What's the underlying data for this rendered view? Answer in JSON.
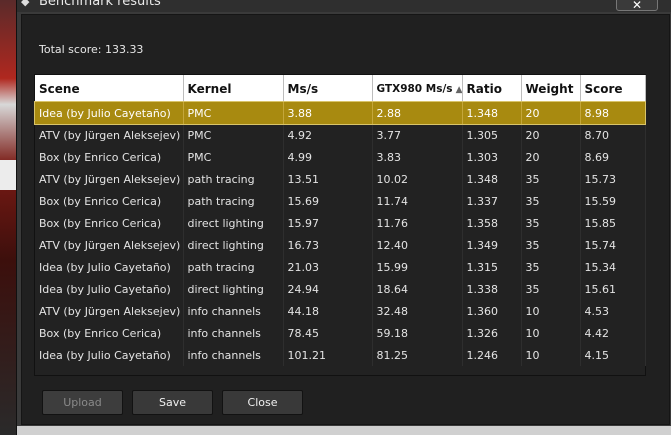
{
  "window": {
    "title": "Benchmark results",
    "close_glyph": "✕"
  },
  "summary": {
    "total_label": "Total score: 133.33"
  },
  "table": {
    "columns": [
      {
        "label": "Scene"
      },
      {
        "label": "Kernel"
      },
      {
        "label": "Ms/s"
      },
      {
        "label": "GTX980 Ms/s",
        "sorted": "ascending"
      },
      {
        "label": "Ratio"
      },
      {
        "label": "Weight"
      },
      {
        "label": "Score"
      }
    ],
    "rows": [
      [
        "Idea (by Julio Cayetaño)",
        "PMC",
        "3.88",
        "2.88",
        "1.348",
        "20",
        "8.98"
      ],
      [
        "ATV (by Jürgen Aleksejev)",
        "PMC",
        "4.92",
        "3.77",
        "1.305",
        "20",
        "8.70"
      ],
      [
        "Box (by Enrico Cerica)",
        "PMC",
        "4.99",
        "3.83",
        "1.303",
        "20",
        "8.69"
      ],
      [
        "ATV (by Jürgen Aleksejev)",
        "path tracing",
        "13.51",
        "10.02",
        "1.348",
        "35",
        "15.73"
      ],
      [
        "Box (by Enrico Cerica)",
        "path tracing",
        "15.69",
        "11.74",
        "1.337",
        "35",
        "15.59"
      ],
      [
        "Box (by Enrico Cerica)",
        "direct lighting",
        "15.97",
        "11.76",
        "1.358",
        "35",
        "15.85"
      ],
      [
        "ATV (by Jürgen Aleksejev)",
        "direct lighting",
        "16.73",
        "12.40",
        "1.349",
        "35",
        "15.74"
      ],
      [
        "Idea (by Julio Cayetaño)",
        "path tracing",
        "21.03",
        "15.99",
        "1.315",
        "35",
        "15.34"
      ],
      [
        "Idea (by Julio Cayetaño)",
        "direct lighting",
        "24.94",
        "18.64",
        "1.338",
        "35",
        "15.61"
      ],
      [
        "ATV (by Jürgen Aleksejev)",
        "info channels",
        "44.18",
        "32.48",
        "1.360",
        "10",
        "4.53"
      ],
      [
        "Box (by Enrico Cerica)",
        "info channels",
        "78.45",
        "59.18",
        "1.326",
        "10",
        "4.42"
      ],
      [
        "Idea (by Julio Cayetaño)",
        "info channels",
        "101.21",
        "81.25",
        "1.246",
        "10",
        "4.15"
      ]
    ],
    "selected_row": 0
  },
  "buttons": {
    "upload": {
      "label": "Upload",
      "enabled": false
    },
    "save": {
      "label": "Save",
      "enabled": true
    },
    "close": {
      "label": "Close",
      "enabled": true
    }
  },
  "colors": {
    "selection": "#a88a10",
    "background": "#202020",
    "header": "#ffffff"
  }
}
